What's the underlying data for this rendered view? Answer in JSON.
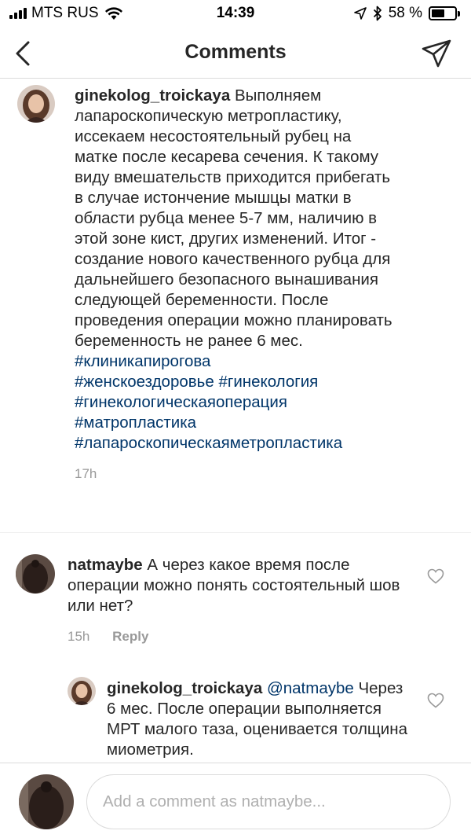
{
  "status_bar": {
    "carrier": "MTS RUS",
    "time": "14:39",
    "battery": "58 %",
    "battery_level": 0.58
  },
  "nav": {
    "title": "Comments"
  },
  "caption": {
    "username": "ginekolog_troickaya",
    "text": "Выполняем лапароскопическую метропластику, иссекаем несостоятельный рубец на матке после кесарева сечения. К такому виду вмешательств приходится прибегать в случае истончение мышцы матки в области рубца менее 5-7 мм, наличию в этой зоне кист, других изменений. Итог - создание нового качественного рубца для дальнейшего безопасного вынашивания следующей беременности. После проведения операции можно планировать беременность не ранее 6 мес.",
    "hashtags": [
      "#клиникапирогова",
      "#женскоездоровье",
      "#гинекология",
      "#гинекологическаяоперация",
      "#матропластика",
      "#лапароскопическаяметропластика"
    ],
    "time": "17h"
  },
  "comments": [
    {
      "username": "natmaybe",
      "text": "А через какое время после операции можно понять состоятельный шов или нет?",
      "time": "15h",
      "reply_label": "Reply"
    }
  ],
  "reply": {
    "username": "ginekolog_troickaya",
    "mention": "@natmaybe",
    "text": "Через 6 мес. После операции выполняется МРТ малого таза, оценивается толщина миометрия."
  },
  "input": {
    "placeholder": "Add a comment as natmaybe..."
  },
  "icons": {
    "back": "chevron-left-icon",
    "send": "paper-plane-icon",
    "like": "heart-outline-icon"
  },
  "colors": {
    "hashtag": "#003569",
    "secondary_text": "#999999",
    "primary_text": "#262626"
  }
}
